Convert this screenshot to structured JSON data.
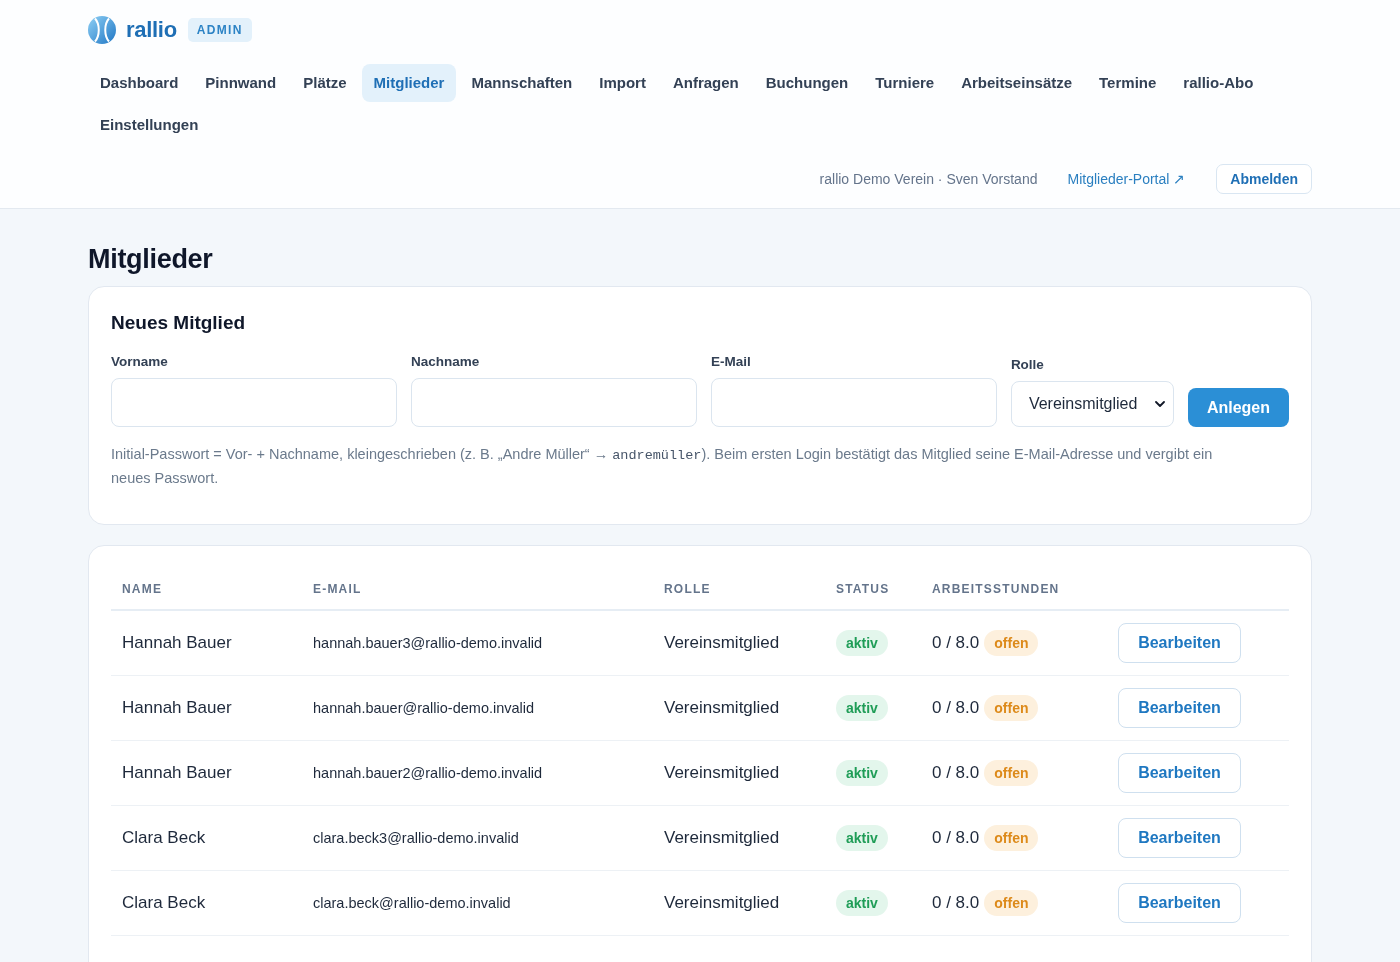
{
  "header": {
    "brand": "rallio",
    "badge": "ADMIN",
    "nav": [
      {
        "label": "Dashboard",
        "selected": false
      },
      {
        "label": "Pinnwand",
        "selected": false
      },
      {
        "label": "Plätze",
        "selected": false
      },
      {
        "label": "Mitglieder",
        "selected": true
      },
      {
        "label": "Mannschaften",
        "selected": false
      },
      {
        "label": "Import",
        "selected": false
      },
      {
        "label": "Anfragen",
        "selected": false
      },
      {
        "label": "Buchungen",
        "selected": false
      },
      {
        "label": "Turniere",
        "selected": false
      },
      {
        "label": "Arbeitseinsätze",
        "selected": false
      },
      {
        "label": "Termine",
        "selected": false
      },
      {
        "label": "rallio-Abo",
        "selected": false
      },
      {
        "label": "Einstellungen",
        "selected": false
      }
    ],
    "account": "rallio Demo Verein · Sven Vorstand",
    "portal_link": "Mitglieder-Portal ↗",
    "logout": "Abmelden"
  },
  "page_title": "Mitglieder",
  "new_member": {
    "title": "Neues Mitglied",
    "fields": [
      {
        "label": "Vorname",
        "kind": "text"
      },
      {
        "label": "Nachname",
        "kind": "text"
      },
      {
        "label": "E-Mail",
        "kind": "text"
      },
      {
        "label": "Rolle",
        "kind": "select",
        "value": "Vereinsmitglied"
      }
    ],
    "submit": "Anlegen",
    "hint": [
      {
        "kind": "text",
        "text": "Initial-Passwort = Vor- + Nachname, kleingeschrieben (z. B. „Andre Müller“ → "
      },
      {
        "kind": "code",
        "text": "andremüller"
      },
      {
        "kind": "text",
        "text": "). Beim ersten Login bestätigt das Mitglied seine E-Mail-Adresse und vergibt ein neues Passwort."
      }
    ]
  },
  "table": {
    "columns": [
      "NAME",
      "E-MAIL",
      "ROLLE",
      "STATUS",
      "ARBEITSSTUNDEN"
    ],
    "rows": [
      {
        "name": "Hannah Bauer",
        "email": "hannah.bauer3@rallio-demo.invalid",
        "role": "Vereinsmitglied",
        "status": {
          "text": "aktiv",
          "kind": "active"
        },
        "hours": "0 / 8.0",
        "hours_status": {
          "text": "offen",
          "kind": "open"
        },
        "action": "Bearbeiten"
      },
      {
        "name": "Hannah Bauer",
        "email": "hannah.bauer@rallio-demo.invalid",
        "role": "Vereinsmitglied",
        "status": {
          "text": "aktiv",
          "kind": "active"
        },
        "hours": "0 / 8.0",
        "hours_status": {
          "text": "offen",
          "kind": "open"
        },
        "action": "Bearbeiten"
      },
      {
        "name": "Hannah Bauer",
        "email": "hannah.bauer2@rallio-demo.invalid",
        "role": "Vereinsmitglied",
        "status": {
          "text": "aktiv",
          "kind": "active"
        },
        "hours": "0 / 8.0",
        "hours_status": {
          "text": "offen",
          "kind": "open"
        },
        "action": "Bearbeiten"
      },
      {
        "name": "Clara Beck",
        "email": "clara.beck3@rallio-demo.invalid",
        "role": "Vereinsmitglied",
        "status": {
          "text": "aktiv",
          "kind": "active"
        },
        "hours": "0 / 8.0",
        "hours_status": {
          "text": "offen",
          "kind": "open"
        },
        "action": "Bearbeiten"
      },
      {
        "name": "Clara Beck",
        "email": "clara.beck@rallio-demo.invalid",
        "role": "Vereinsmitglied",
        "status": {
          "text": "aktiv",
          "kind": "active"
        },
        "hours": "0 / 8.0",
        "hours_status": {
          "text": "offen",
          "kind": "open"
        },
        "action": "Bearbeiten"
      }
    ]
  }
}
